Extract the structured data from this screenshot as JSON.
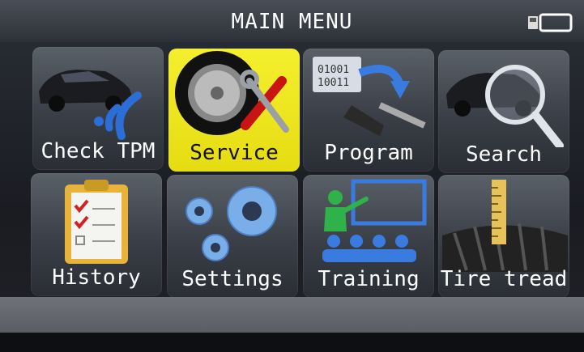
{
  "window": {
    "title": "MAIN MENU"
  },
  "status": {
    "battery_icon": "battery-icon",
    "sd_icon": "sd-card-icon"
  },
  "menu": {
    "items": [
      {
        "label": "Check  TPM",
        "icon": "car-signal-icon",
        "selected": false
      },
      {
        "label": "Service",
        "icon": "tire-tools-icon",
        "selected": true
      },
      {
        "label": "Program",
        "icon": "program-download-icon",
        "selected": false
      },
      {
        "label": "Search",
        "icon": "magnifier-car-icon",
        "selected": false
      },
      {
        "label": "History",
        "icon": "clipboard-checklist-icon",
        "selected": false
      },
      {
        "label": "Settings",
        "icon": "gears-icon",
        "selected": false
      },
      {
        "label": "Training",
        "icon": "classroom-icon",
        "selected": false
      },
      {
        "label": "Tire  tread",
        "icon": "tire-tread-ruler-icon",
        "selected": false
      }
    ]
  },
  "colors": {
    "accent": "#f0e825",
    "tile": "#4a4f57",
    "bottombar": "#63666c"
  }
}
